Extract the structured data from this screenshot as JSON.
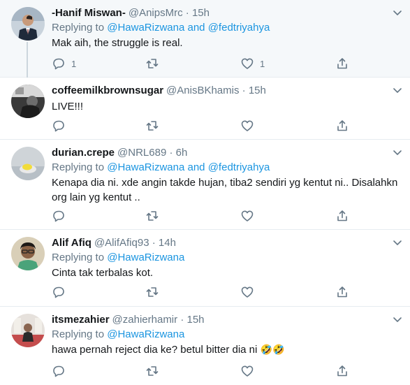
{
  "tweets": [
    {
      "name": "-Hanif Miswan-",
      "handle": "@AnipsMrc",
      "sep": "·",
      "time": "15h",
      "replying_prefix": "Replying to",
      "mention1": "@HawaRizwana",
      "joiner": "and",
      "mention2": "@fedtriyahya",
      "text": "Mak aih, the struggle is real.",
      "replies": "1",
      "likes": "1"
    },
    {
      "name": "coffeemilkbrownsugar",
      "handle": "@AnisBKhamis",
      "sep": "·",
      "time": "15h",
      "text": "LIVE!!!"
    },
    {
      "name": "durian.crepe",
      "handle": "@NRL689",
      "sep": "·",
      "time": "6h",
      "replying_prefix": "Replying to",
      "mention1": "@HawaRizwana",
      "joiner": "and",
      "mention2": "@fedtriyahya",
      "text_line1": "Kenapa dia ni. xde angin takde hujan, tiba2 sendiri yg kentut ni.. Disalahkn",
      "text_line2": "org lain yg kentut .."
    },
    {
      "name": "Alif Afiq",
      "handle": "@AlifAfiq93",
      "sep": "·",
      "time": "14h",
      "replying_prefix": "Replying to",
      "mention1": "@HawaRizwana",
      "text": "Cinta tak terbalas kot."
    },
    {
      "name": "itsmezahier",
      "handle": "@zahierhamir",
      "sep": "·",
      "time": "15h",
      "replying_prefix": "Replying to",
      "mention1": "@HawaRizwana",
      "text": "hawa pernah reject dia ke? betul bitter dia ni",
      "emoji": "🤣🤣"
    }
  ],
  "icons": {
    "reply": "reply-icon",
    "retweet": "retweet-icon",
    "like": "heart-icon",
    "share": "share-icon",
    "more": "chevron-down-icon"
  },
  "colors": {
    "link": "#1b95e0",
    "muted": "#657786",
    "highlight_bg": "#f5f8fa",
    "border": "#e6ecf0"
  }
}
